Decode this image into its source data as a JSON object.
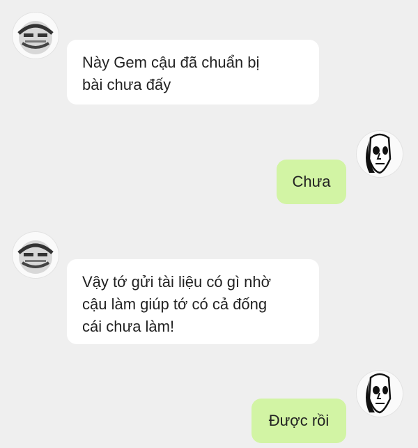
{
  "messages": [
    {
      "sender": "other",
      "avatar": "smiling-face-avatar",
      "lines": [
        "Này Gem cậu đã chuẩn bị",
        "bài chưa đấy"
      ]
    },
    {
      "sender": "self",
      "avatar": "skull-face-avatar",
      "lines": [
        "Chưa"
      ]
    },
    {
      "sender": "other",
      "avatar": "smiling-face-avatar",
      "lines": [
        "Vậy tớ gửi tài liệu có gì nhờ",
        "cậu làm giúp tớ có cả đống",
        "cái chưa làm!"
      ]
    },
    {
      "sender": "self",
      "avatar": "skull-face-avatar",
      "lines": [
        "Được rồi"
      ]
    }
  ],
  "colors": {
    "background": "#efefef",
    "incoming_bubble": "#ffffff",
    "outgoing_bubble": "#d2f4a4",
    "text": "#222222"
  }
}
